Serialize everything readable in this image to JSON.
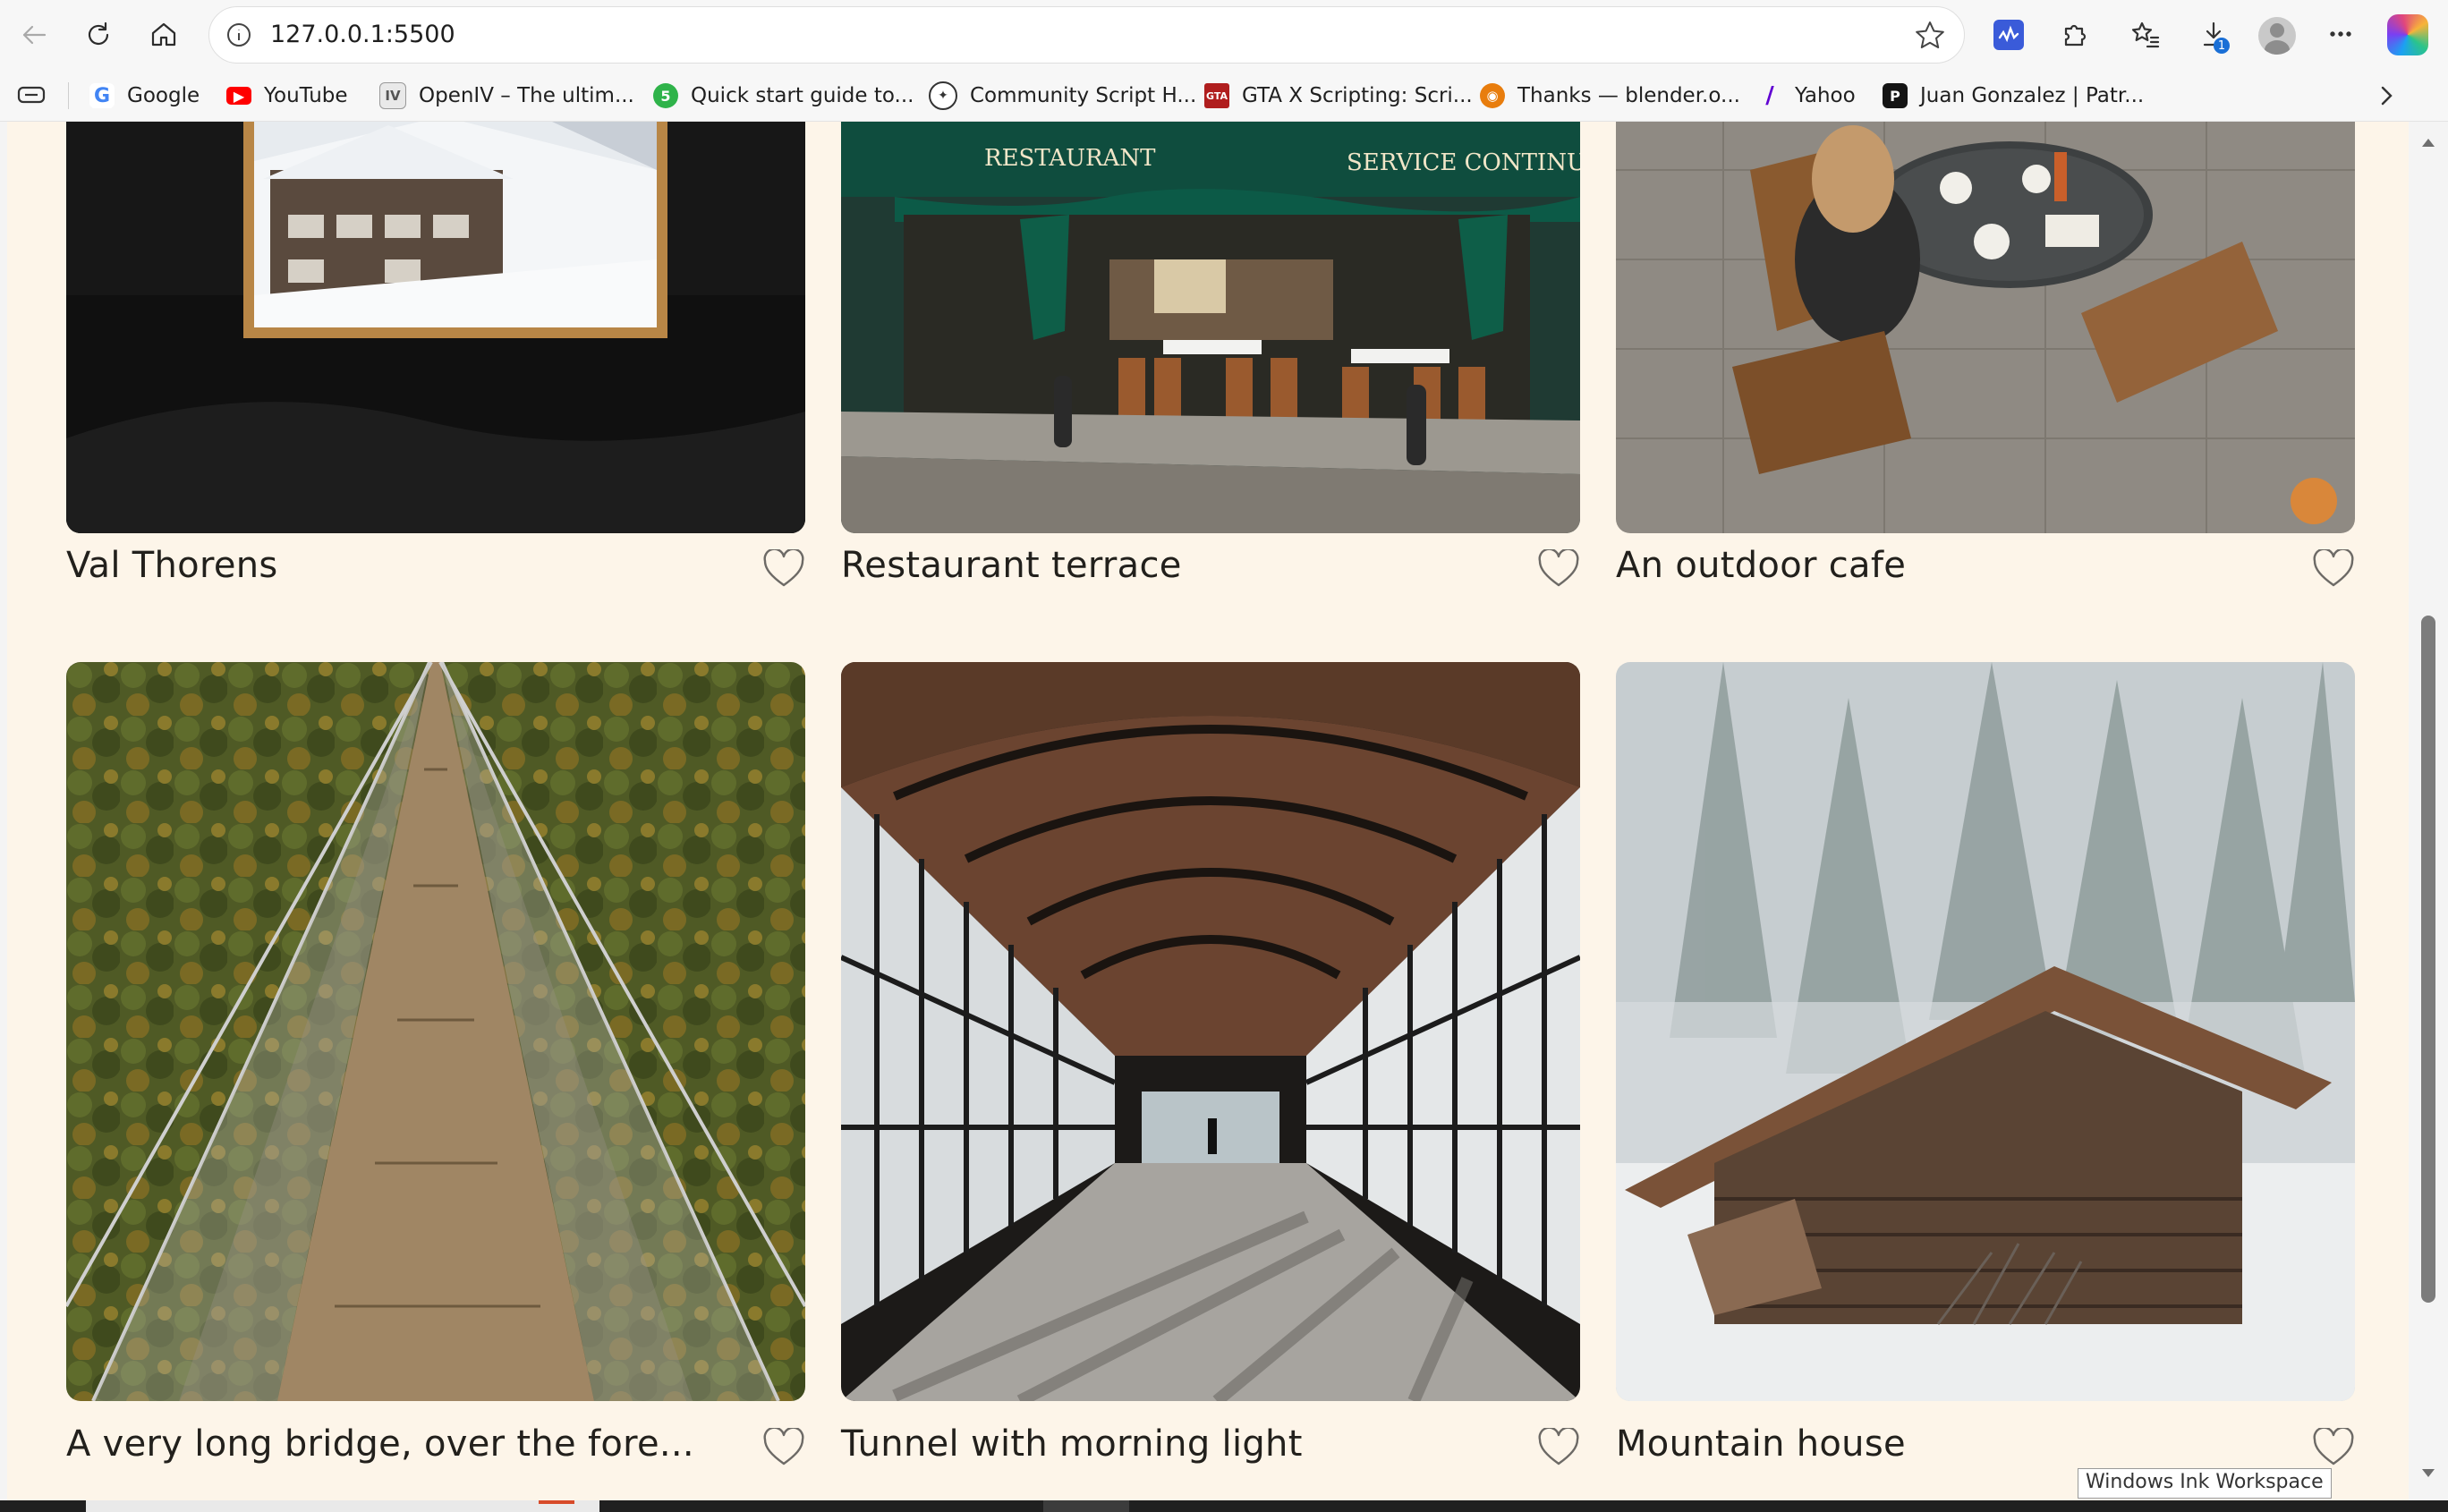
{
  "browser": {
    "url": "127.0.0.1:5500",
    "download_badge": "1",
    "bookmarks": [
      {
        "label": "Google",
        "icon": "google-icon",
        "color": "#4285f4"
      },
      {
        "label": "YouTube",
        "icon": "youtube-icon",
        "color": "#ff0000"
      },
      {
        "label": "OpenIV – The ultim...",
        "icon": "openiv-icon",
        "color": "#6b6b6b"
      },
      {
        "label": "Quick start guide to...",
        "icon": "guide-icon",
        "color": "#2fb34a"
      },
      {
        "label": "Community Script H...",
        "icon": "community-icon",
        "color": "#333333"
      },
      {
        "label": "GTA X Scripting: Scri...",
        "icon": "gta-icon",
        "color": "#b01e1e"
      },
      {
        "label": "Thanks — blender.o...",
        "icon": "blender-icon",
        "color": "#e87d0d"
      },
      {
        "label": "Yahoo",
        "icon": "yahoo-icon",
        "color": "#6001d2"
      },
      {
        "label": "Juan Gonzalez | Patr...",
        "icon": "patreon-icon",
        "color": "#141414"
      }
    ]
  },
  "gallery": {
    "cards": [
      {
        "title": "Val Thorens",
        "image": "val-thorens-photo"
      },
      {
        "title": "Restaurant terrace",
        "image": "restaurant-terrace-photo"
      },
      {
        "title": "An outdoor cafe",
        "image": "outdoor-cafe-photo"
      },
      {
        "title": "A very long bridge, over the fore...",
        "image": "long-bridge-photo"
      },
      {
        "title": "Tunnel with morning light",
        "image": "tunnel-photo"
      },
      {
        "title": "Mountain house",
        "image": "mountain-house-photo"
      }
    ],
    "restaurant_sign_left": "RESTAURANT",
    "restaurant_sign_right": "SERVICE CONTINU"
  },
  "overlay": {
    "ink_workspace": "Windows Ink Workspace"
  },
  "colors": {
    "page_background": "#fdf5e9",
    "heart": "#6d6a66",
    "title_text": "#22201c"
  }
}
